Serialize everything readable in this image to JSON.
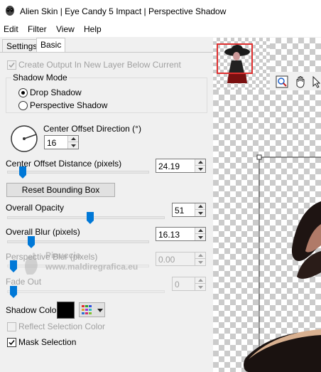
{
  "window": {
    "title": "Alien Skin | Eye Candy 5 Impact | Perspective Shadow"
  },
  "menu": {
    "items": [
      "Edit",
      "Filter",
      "View",
      "Help"
    ]
  },
  "tabs": [
    "Settings",
    "Basic"
  ],
  "active_tab": "Basic",
  "basic": {
    "create_output_label": "Create Output In New Layer Below Current",
    "shadow_mode_label": "Shadow Mode",
    "drop_shadow_label": "Drop Shadow",
    "perspective_shadow_label": "Perspective Shadow",
    "shadow_mode_selected": "Drop Shadow",
    "center_offset_direction_label": "Center Offset Direction (°)",
    "center_offset_direction_value": "16",
    "center_offset_distance_label": "Center Offset Distance (pixels)",
    "center_offset_distance_value": "24.19",
    "reset_bounding_box_label": "Reset Bounding Box",
    "overall_opacity_label": "Overall Opacity",
    "overall_opacity_value": "51",
    "overall_blur_label": "Overall Blur (pixels)",
    "overall_blur_value": "16.13",
    "perspective_blur_label": "Perspective Blur (pixels)",
    "perspective_blur_value": "0.00",
    "fade_out_label": "Fade Out",
    "fade_out_value": "0",
    "shadow_color_label": "Shadow Color",
    "shadow_color": "#000000",
    "reflect_selection_color_label": "Reflect Selection Color",
    "mask_selection_label": "Mask Selection",
    "create_output_checked": true,
    "reflect_selection_color_checked": false,
    "mask_selection_checked": true
  },
  "watermark": {
    "line1": "Pinuccia",
    "line2": "www.maldiregrafica.eu"
  },
  "colors": {
    "accent_red": "#e03030",
    "slider_blue": "#0078d7"
  }
}
